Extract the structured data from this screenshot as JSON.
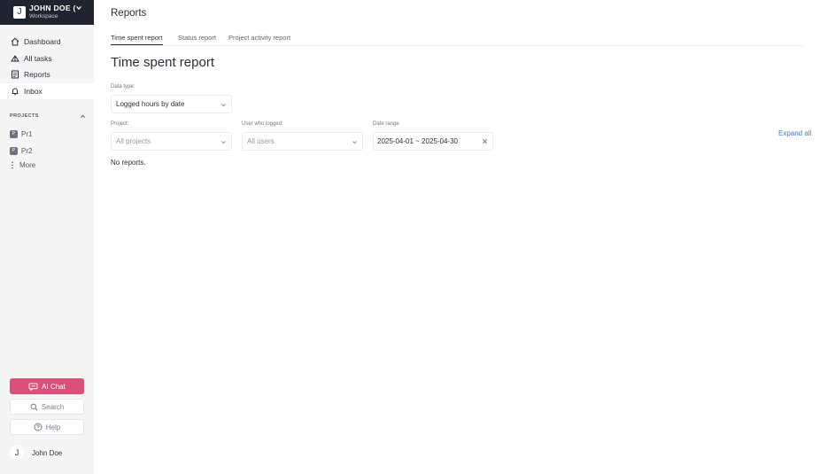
{
  "workspace": {
    "avatar": "J",
    "name": "JOHN DOE (",
    "subtitle": "Workspace"
  },
  "sidebar": {
    "items": [
      {
        "label": "Dashboard",
        "icon": "home-icon"
      },
      {
        "label": "All tasks",
        "icon": "tasks-icon"
      },
      {
        "label": "Reports",
        "icon": "reports-icon"
      },
      {
        "label": "Inbox",
        "icon": "bell-icon"
      }
    ],
    "projects_title": "PROJECTS",
    "projects": [
      {
        "badge": "P",
        "label": "Pr1"
      },
      {
        "badge": "P",
        "label": "Pr2"
      }
    ],
    "more_label": "More",
    "ai_chat_label": "AI Chat",
    "search_label": "Search",
    "help_label": "Help",
    "user": {
      "avatar": "J",
      "name": "John Doe"
    }
  },
  "header": {
    "title": "Reports"
  },
  "tabs": [
    {
      "label": "Time spent report",
      "active": true
    },
    {
      "label": "Status report",
      "active": false
    },
    {
      "label": "Project activity report",
      "active": false
    }
  ],
  "report": {
    "title": "Time spent report",
    "data_type_label": "Data type:",
    "data_type_value": "Logged hours by date",
    "project_label": "Project:",
    "project_placeholder": "All projects",
    "user_label": "User who logged:",
    "user_placeholder": "All users",
    "date_range_label": "Date range",
    "date_range_value": "2025-04-01 ~ 2025-04-30",
    "expand_label": "Expand all",
    "empty_text": "No reports."
  },
  "colors": {
    "sidebar_header": "#1f2430",
    "ai_button": "#d9507a",
    "link": "#3a7bd5"
  }
}
